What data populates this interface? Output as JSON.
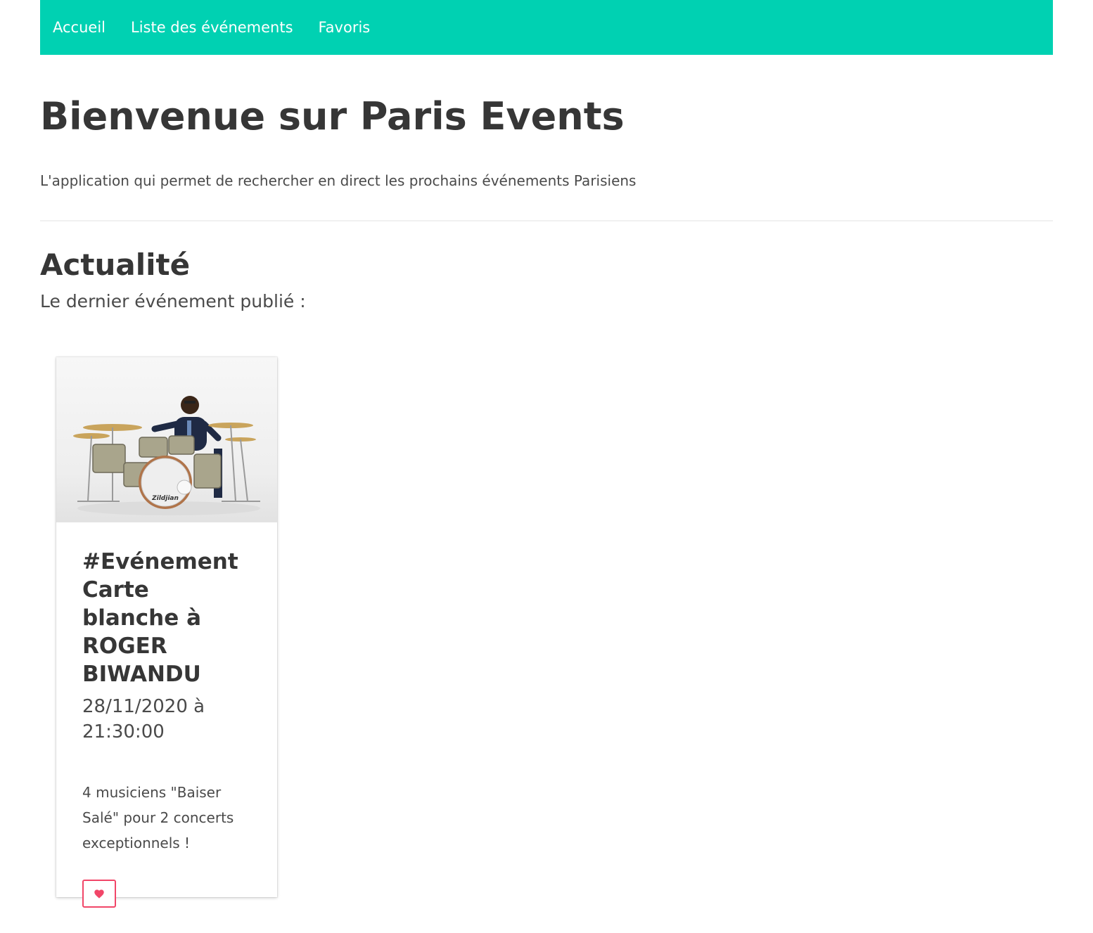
{
  "nav": {
    "items": [
      {
        "label": "Accueil"
      },
      {
        "label": "Liste des événements"
      },
      {
        "label": "Favoris"
      }
    ],
    "background_color": "#00d1b2"
  },
  "hero": {
    "title": "Bienvenue sur Paris Events",
    "subtitle": "L'application qui permet de rechercher en direct les prochains événements Parisiens"
  },
  "news": {
    "title": "Actualité",
    "subtitle": "Le dernier événement publié :"
  },
  "event_card": {
    "image_text": "Zildjian",
    "title": "#Evénement Carte blanche à ROGER BIWANDU",
    "date": "28/11/2020 à 21:30:00",
    "description": "4 musiciens \"Baiser Salé\" pour 2 concerts exceptionnels !",
    "favorite_icon": "heart-icon",
    "favorite_color": "#f14668"
  }
}
